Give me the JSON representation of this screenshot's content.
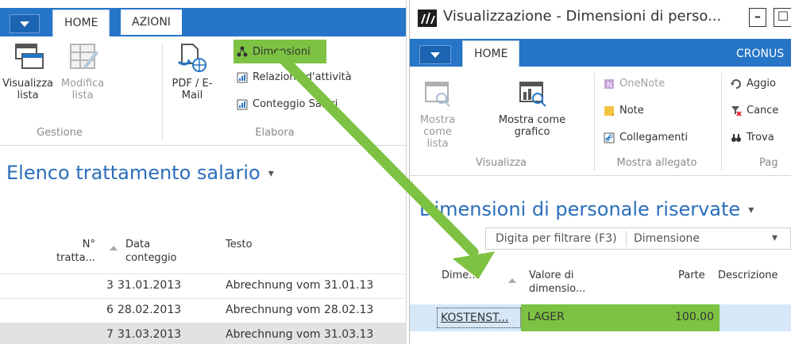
{
  "left": {
    "tabs": [
      "HOME",
      "AZIONI"
    ],
    "ribbon": {
      "groups": [
        {
          "label": "Gestione",
          "buttons": [
            {
              "label": "Visualizza\nlista",
              "line1": "Visualizza",
              "line2": "lista",
              "icon": "list-view-icon",
              "enabled": true
            },
            {
              "label": "Modifica lista",
              "line1": "Modifica",
              "line2": "lista",
              "icon": "edit-list-icon",
              "enabled": false
            }
          ]
        },
        {
          "label": "Elabora",
          "buttons": [
            {
              "label": "PDF / E-Mail",
              "line1": "PDF / E-",
              "line2": "Mail",
              "icon": "pdf-email-icon",
              "enabled": true
            }
          ],
          "items": [
            {
              "label": "Dimensioni",
              "icon": "dimensions-icon",
              "highlight": true
            },
            {
              "label": "Relazione d'attività",
              "icon": "report-icon"
            },
            {
              "label": "Conteggio Salari",
              "icon": "report-icon"
            }
          ]
        }
      ]
    },
    "page_title": "Elenco trattamento salario",
    "columns": [
      "N°\ntratta...",
      "Data\nconteggio",
      "Testo"
    ],
    "col_labels": {
      "no_1": "N°",
      "no_2": "tratta...",
      "date_1": "Data",
      "date_2": "conteggio",
      "text": "Testo"
    },
    "rows": [
      {
        "no": "3",
        "date": "31.01.2013",
        "text": "Abrechnung vom 31.01.13"
      },
      {
        "no": "6",
        "date": "28.02.2013",
        "text": "Abrechnung vom 28.02.13"
      },
      {
        "no": "7",
        "date": "31.03.2013",
        "text": "Abrechnung vom 31.03.13"
      }
    ]
  },
  "right": {
    "window_title": "Visualizzazione - Dimensioni di perso...",
    "win_min": "–",
    "win_max": "☐",
    "tabs": [
      "HOME",
      "CRONUS"
    ],
    "ribbon": {
      "visualizza_label": "Visualizza",
      "btn_lista_1": "Mostra",
      "btn_lista_2": "come lista",
      "btn_grafico_1": "Mostra come",
      "btn_grafico_2": "grafico",
      "allegato_label": "Mostra allegato",
      "items": [
        "OneNote",
        "Note",
        "Collegamenti"
      ],
      "pag_items": [
        "Aggio",
        "Cance",
        "Trova"
      ],
      "pag_label": "Pag"
    },
    "page_title": "Dimensioni di personale riservate",
    "filter_placeholder": "Digita per filtrare (F3)",
    "filter_field": "Dimensione",
    "columns": {
      "dim": "Dime...",
      "val_1": "Valore di",
      "val_2": "dimensio...",
      "part": "Parte",
      "desc": "Descrizione"
    },
    "rows": [
      {
        "dim": "KOSTENST...",
        "val": "LAGER",
        "part": "100.00"
      }
    ]
  },
  "colors": {
    "accent_blue": "#2675c7",
    "highlight_green": "#7dc242",
    "title_blue": "#2a6ebb"
  }
}
